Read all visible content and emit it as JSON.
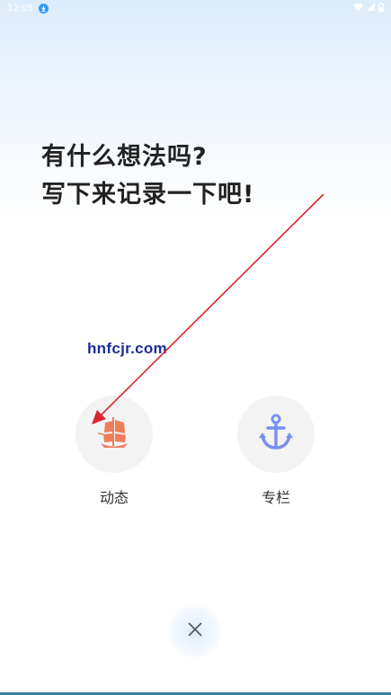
{
  "status_bar": {
    "time": "12:05"
  },
  "headline": {
    "line1": "有什么想法吗?",
    "line2": "写下来记录一下吧!"
  },
  "watermark": "hnfcjr.com",
  "options": [
    {
      "label": "动态",
      "icon": "sailboat-icon"
    },
    {
      "label": "专栏",
      "icon": "anchor-icon"
    }
  ],
  "colors": {
    "sailboat": "#f07d5a",
    "anchor": "#7b8ff0",
    "arrow": "#d9262c",
    "watermark": "#1d2d9b"
  }
}
